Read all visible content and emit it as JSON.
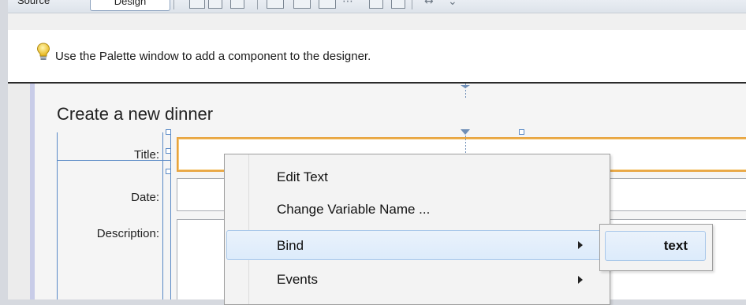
{
  "toolbar": {
    "source_tab": "Source",
    "design_tab": "Design"
  },
  "hint": {
    "icon": "lightbulb-icon",
    "text": "Use the Palette window to add a component to the designer."
  },
  "form": {
    "heading": "Create a new dinner",
    "labels": {
      "title": "Title:",
      "date": "Date:",
      "description": "Description:"
    }
  },
  "context_menu": {
    "items": [
      {
        "label": "Edit Text",
        "has_submenu": false
      },
      {
        "label": "Change Variable Name ...",
        "has_submenu": false
      },
      {
        "label": "Bind",
        "has_submenu": true,
        "highlighted": true
      },
      {
        "label": "Events",
        "has_submenu": true
      }
    ],
    "submenu": {
      "items": [
        {
          "label": "text"
        }
      ]
    }
  },
  "colors": {
    "selection_border": "#e8a33d",
    "guide_lines": "#5a8ac6",
    "menu_highlight": "#dcebfb"
  }
}
